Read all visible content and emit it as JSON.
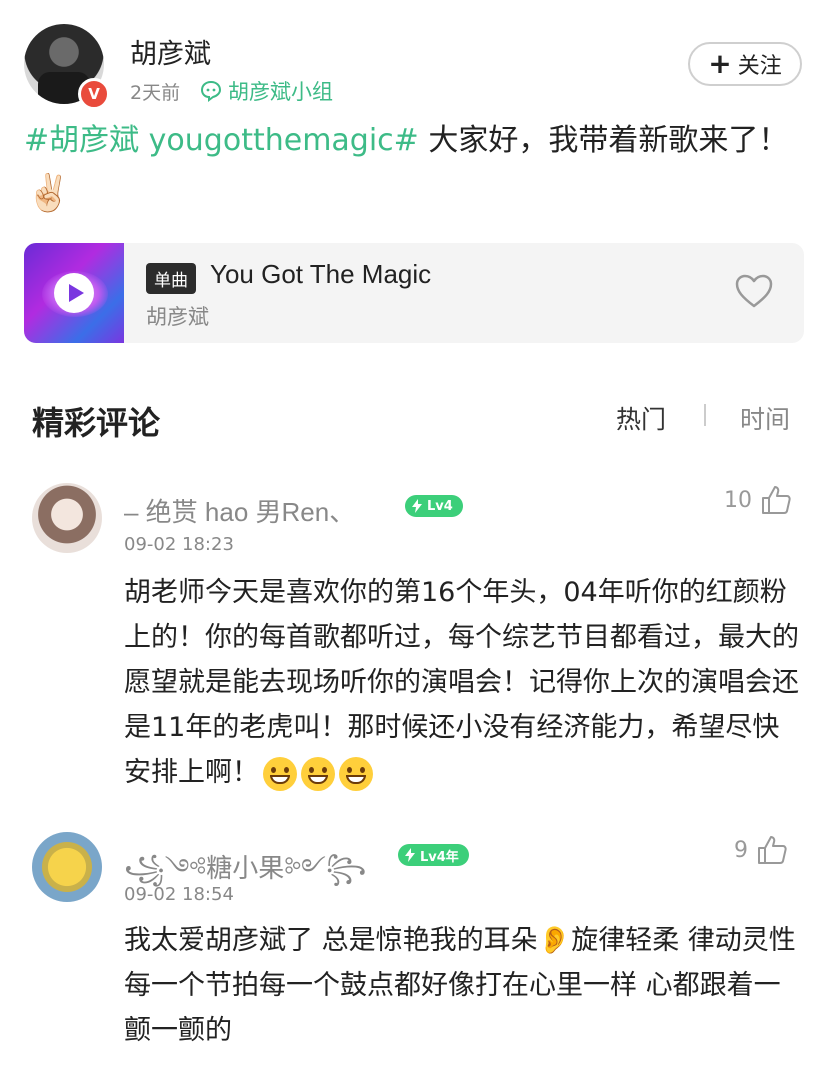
{
  "post": {
    "author": "胡彦斌",
    "time": "2天前",
    "group": "胡彦斌小组",
    "follow_label": "关注",
    "follow_plus": "+",
    "verified_mark": "V",
    "hashtag": "#胡彦斌 yougotthemagic#",
    "text": " 大家好，我带着新歌来了！",
    "emoji": "✌🏻"
  },
  "music": {
    "tag": "单曲",
    "title": "You Got The Magic",
    "artist": "胡彦斌"
  },
  "comments_section": {
    "title": "精彩评论",
    "sort_hot": "热门",
    "sort_time": "时间"
  },
  "comments": [
    {
      "name": "– 绝贳 hao 男Ren、",
      "level": "Lv4",
      "time": "09-02 18:23",
      "likes": "10",
      "text": "胡老师今天是喜欢你的第16个年头，04年听你的红颜粉上的！你的每首歌都听过，每个综艺节目都看过，最大的愿望就是能去现场听你的演唱会！记得你上次的演唱会还是11年的老虎叫！那时候还小没有经济能力，希望尽快安排上啊！"
    },
    {
      "name": "꧁༺糖小果༻꧂",
      "level": "Lv4年",
      "time": "09-02 18:54",
      "likes": "9",
      "text": "我太爱胡彦斌了 总是惊艳我的耳朵👂旋律轻柔 律动灵性 每一个节拍每一个鼓点都好像打在心里一样 心都跟着一颤一颤的"
    }
  ],
  "colors": {
    "accent": "#3dbb87",
    "level_badge": "#3ccf7a",
    "verified": "#e94b3c"
  }
}
